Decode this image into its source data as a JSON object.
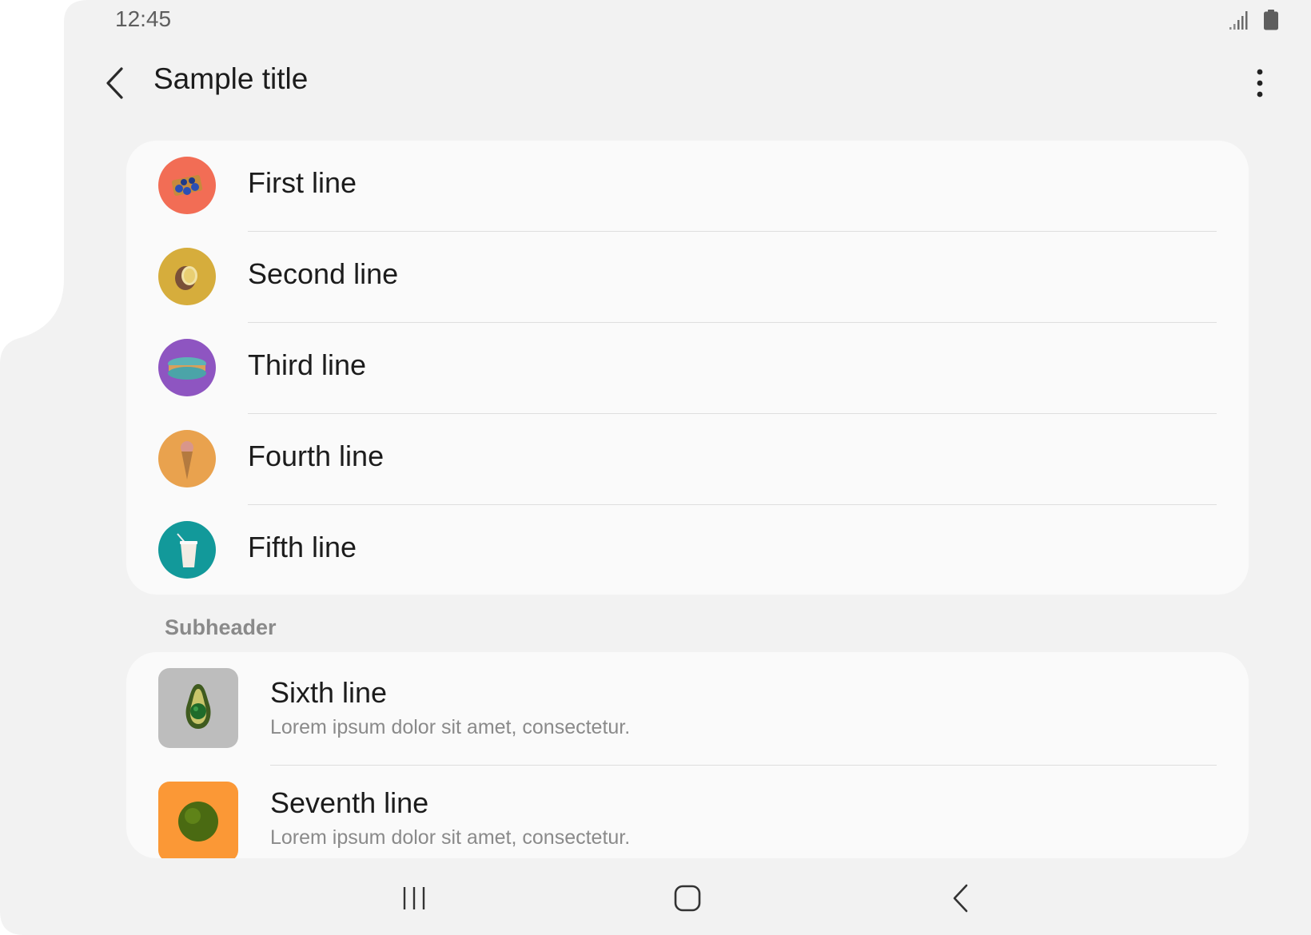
{
  "status_bar": {
    "time": "12:45",
    "signal_icon": "signal-icon",
    "battery_icon": "battery-icon"
  },
  "app_bar": {
    "title": "Sample title",
    "back_icon": "chevron-left-icon",
    "more_icon": "more-vert-icon"
  },
  "list1": {
    "items": [
      {
        "label": "First line",
        "avatar_color": "#f26d55"
      },
      {
        "label": "Second line",
        "avatar_color": "#d6ad3c"
      },
      {
        "label": "Third line",
        "avatar_color": "#8e55c1"
      },
      {
        "label": "Fourth line",
        "avatar_color": "#e9a24e"
      },
      {
        "label": "Fifth line",
        "avatar_color": "#12999a"
      }
    ]
  },
  "subheader": "Subheader",
  "list2": {
    "items": [
      {
        "title": "Sixth line",
        "subtitle": "Lorem ipsum dolor sit amet, consectetur.",
        "thumb_color": "#bdbdbd"
      },
      {
        "title": "Seventh line",
        "subtitle": "Lorem ipsum dolor sit amet, consectetur.",
        "thumb_color": "#fb9836"
      }
    ]
  },
  "nav_bar": {
    "recents_icon": "recents-icon",
    "home_icon": "home-icon",
    "back_icon": "back-icon"
  },
  "colors": {
    "background": "#f2f2f2",
    "card": "#fafafa",
    "divider": "#dedede",
    "secondary_text": "#8a8a8a"
  }
}
